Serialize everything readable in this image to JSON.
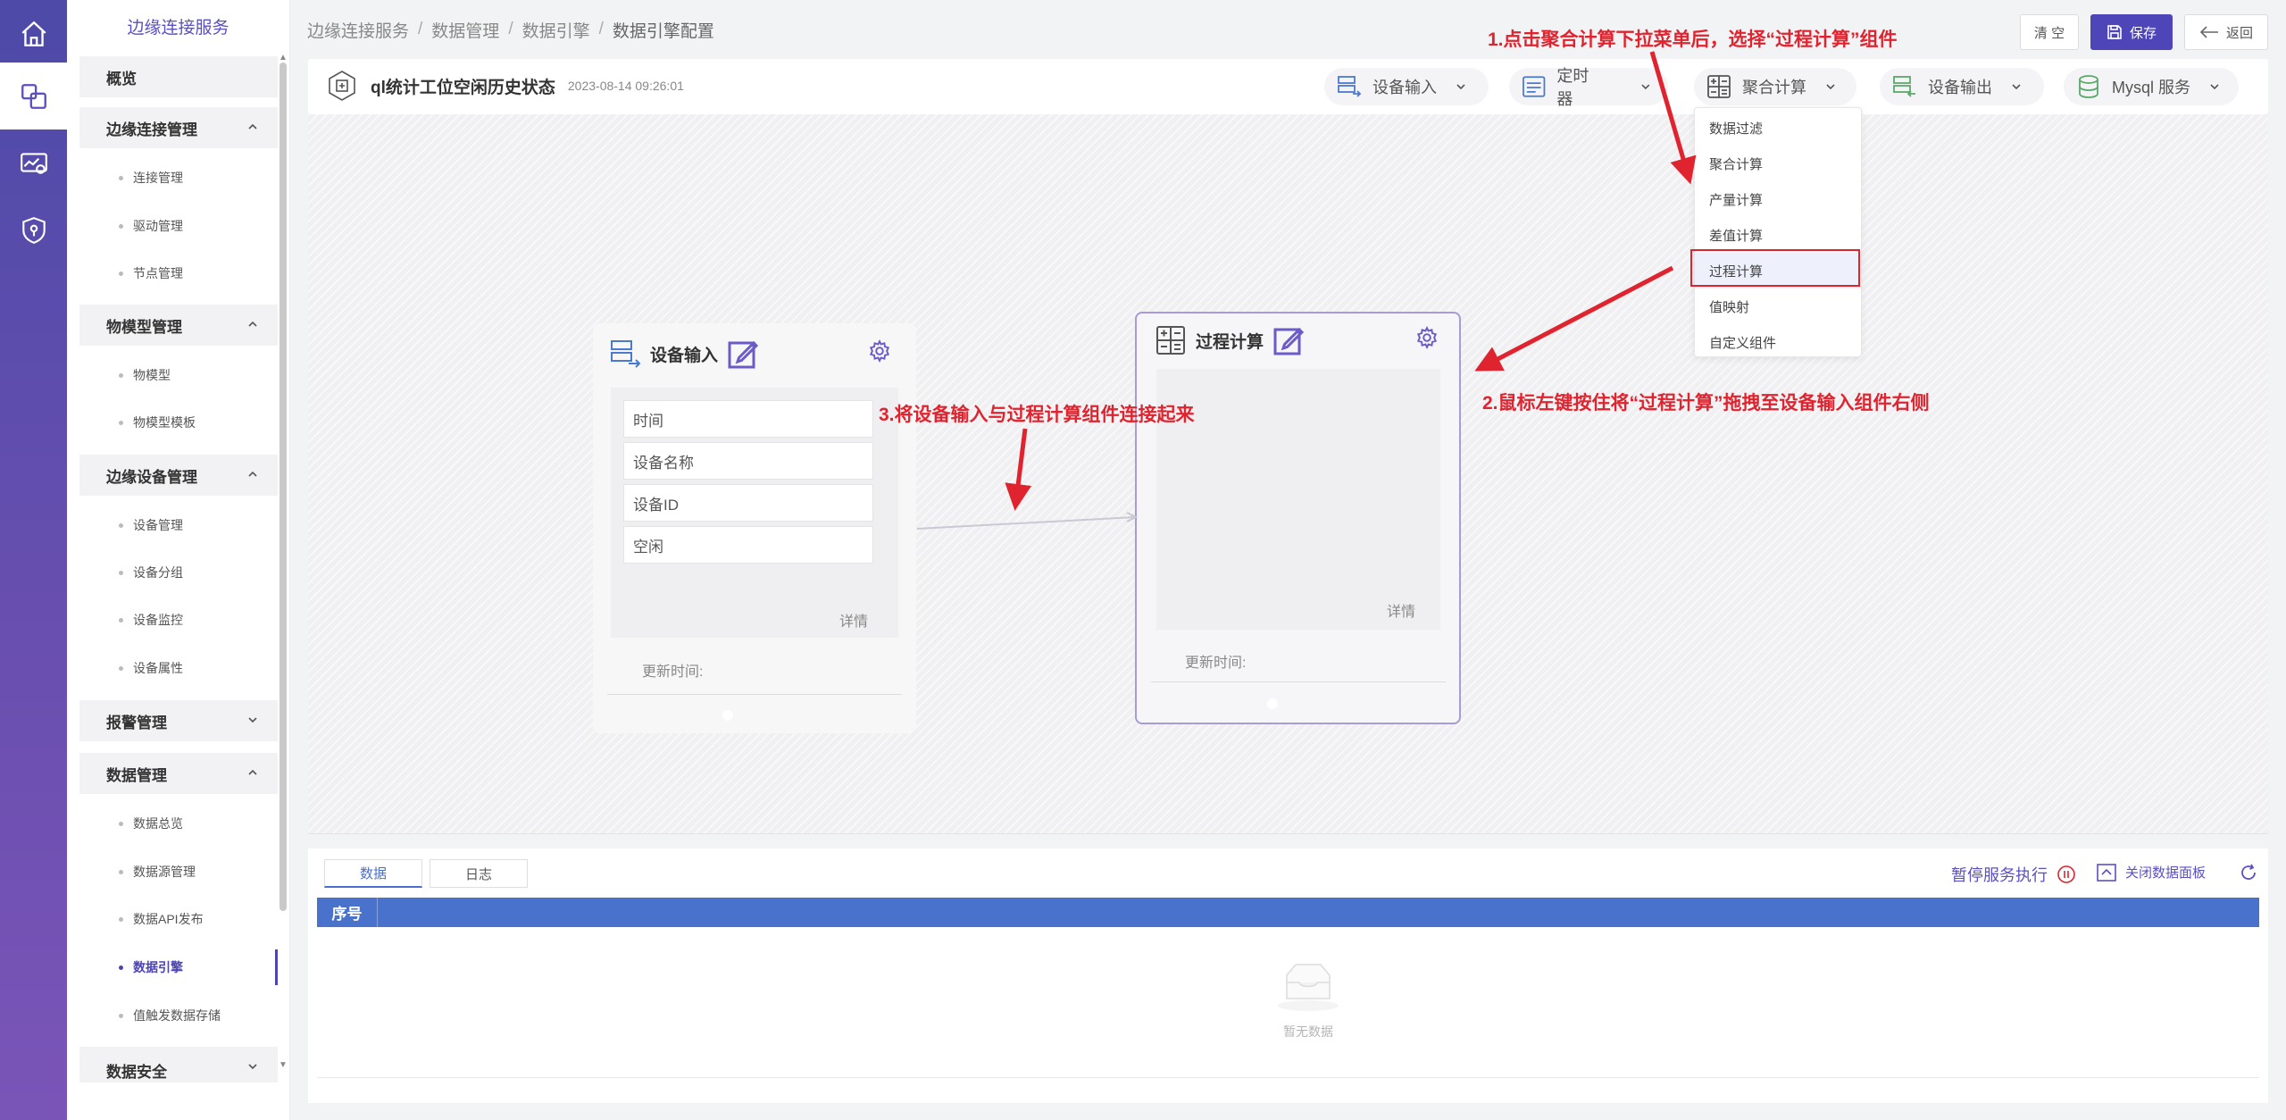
{
  "rail": {
    "items": [
      {
        "name": "home-icon"
      },
      {
        "name": "edge-service-icon",
        "active": true
      },
      {
        "name": "monitor-icon"
      },
      {
        "name": "security-shield-icon"
      }
    ]
  },
  "sidebar": {
    "brand": "边缘连接服务",
    "overview": "概览",
    "groups": {
      "edge_conn": "边缘连接管理",
      "model": "物模型管理",
      "device": "边缘设备管理",
      "alarm": "报警管理",
      "data": "数据管理",
      "security": "数据安全"
    },
    "items": {
      "conn_mgmt": "连接管理",
      "driver_mgmt": "驱动管理",
      "node_mgmt": "节点管理",
      "model": "物模型",
      "model_tpl": "物模型模板",
      "device_mgmt": "设备管理",
      "device_group": "设备分组",
      "device_monitor": "设备监控",
      "device_attr": "设备属性",
      "data_overview": "数据总览",
      "datasource_mgmt": "数据源管理",
      "data_api": "数据API发布",
      "data_engine": "数据引擎",
      "trigger_store": "值触发数据存储"
    }
  },
  "breadcrumb": [
    "边缘连接服务",
    "数据管理",
    "数据引擎",
    "数据引擎配置"
  ],
  "top_actions": {
    "clear": "清 空",
    "save": "保存",
    "back": "返回"
  },
  "flow": {
    "title": "ql统计工位空闲历史状态",
    "date": "2023-08-14 09:26:01"
  },
  "toolbar": {
    "device_input": "设备输入",
    "timer": "定时器",
    "aggregate": "聚合计算",
    "device_output": "设备输出",
    "mysql": "Mysql 服务"
  },
  "dropdown": {
    "items": [
      "数据过滤",
      "聚合计算",
      "产量计算",
      "差值计算",
      "过程计算",
      "值映射",
      "自定义组件"
    ],
    "selected": "过程计算"
  },
  "nodes": {
    "input": {
      "title": "设备输入",
      "fields": [
        "时间",
        "设备名称",
        "设备ID",
        "空闲"
      ],
      "detail": "详情",
      "update": "更新时间:"
    },
    "process": {
      "title": "过程计算",
      "detail": "详情",
      "update": "更新时间:"
    }
  },
  "annotations": {
    "step1": "1.点击聚合计算下拉菜单后，选择“过程计算”组件",
    "step2": "2.鼠标左键按住将“过程计算”拖拽至设备输入组件右侧",
    "step3": "3.将设备输入与过程计算组件连接起来"
  },
  "panel": {
    "tabs": [
      "数据",
      "日志"
    ],
    "pause": "暂停服务执行",
    "close": "关闭数据面板",
    "column_seq": "序号",
    "empty": "暂无数据"
  },
  "colors": {
    "brand": "#4e46b8",
    "annotation": "#e0242f",
    "table_header": "#4872cc"
  }
}
